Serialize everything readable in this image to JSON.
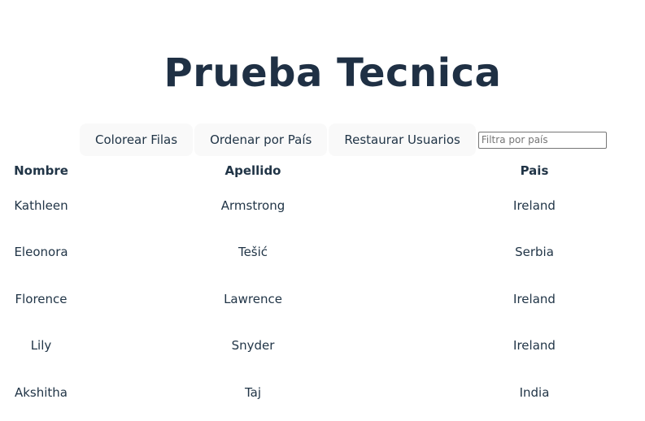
{
  "title": "Prueba Tecnica",
  "controls": {
    "color_rows_label": "Colorear Filas",
    "sort_by_country_label": "Ordenar por País",
    "restore_users_label": "Restaurar Usuarios",
    "filter_placeholder": "Filtra por país",
    "filter_value": ""
  },
  "table": {
    "headers": [
      "Nombre",
      "Apellido",
      "Pais"
    ],
    "rows": [
      {
        "first": "Kathleen",
        "last": "Armstrong",
        "country": "Ireland"
      },
      {
        "first": "Eleonora",
        "last": "Tešić",
        "country": "Serbia"
      },
      {
        "first": "Florence",
        "last": "Lawrence",
        "country": "Ireland"
      },
      {
        "first": "Lily",
        "last": "Snyder",
        "country": "Ireland"
      },
      {
        "first": "Akshitha",
        "last": "Taj",
        "country": "India"
      }
    ]
  }
}
